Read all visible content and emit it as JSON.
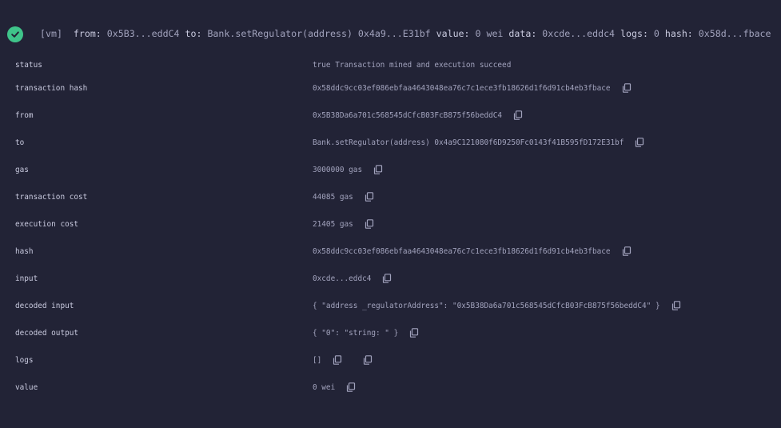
{
  "header": {
    "tag": "[vm]",
    "from_key": "from:",
    "from_val": "0x5B3...eddC4",
    "to_key": "to:",
    "to_val": "Bank.setRegulator(address) 0x4a9...E31bf",
    "value_key": "value:",
    "value_val": "0 wei",
    "data_key": "data:",
    "data_val": "0xcde...eddc4",
    "logs_key": "logs:",
    "logs_val": "0",
    "hash_key": "hash:",
    "hash_val": "0x58d...fbace",
    "status_icon": "check-circle-icon",
    "status_color": "#3fc48a"
  },
  "details": [
    {
      "label": "status",
      "value": "true Transaction mined and execution succeed",
      "copy": 0
    },
    {
      "label": "transaction hash",
      "value": "0x58ddc9cc03ef086ebfaa4643048ea76c7c1ece3fb18626d1f6d91cb4eb3fbace",
      "copy": 1
    },
    {
      "label": "from",
      "value": "0x5B38Da6a701c568545dCfcB03FcB875f56beddC4",
      "copy": 1
    },
    {
      "label": "to",
      "value": "Bank.setRegulator(address) 0x4a9C121080f6D9250Fc0143f41B595fD172E31bf",
      "copy": 1
    },
    {
      "label": "gas",
      "value": "3000000 gas",
      "copy": 1
    },
    {
      "label": "transaction cost",
      "value": "44085 gas",
      "copy": 1
    },
    {
      "label": "execution cost",
      "value": "21405 gas",
      "copy": 1
    },
    {
      "label": "hash",
      "value": "0x58ddc9cc03ef086ebfaa4643048ea76c7c1ece3fb18626d1f6d91cb4eb3fbace",
      "copy": 1
    },
    {
      "label": "input",
      "value": "0xcde...eddc4",
      "copy": 1
    },
    {
      "label": "decoded input",
      "value": "{ \"address _regulatorAddress\": \"0x5B38Da6a701c568545dCfcB03FcB875f56beddC4\" }",
      "copy": 1
    },
    {
      "label": "decoded output",
      "value": "{ \"0\": \"string: \" }",
      "copy": 1
    },
    {
      "label": "logs",
      "value": "[]",
      "copy": 2
    },
    {
      "label": "value",
      "value": "0 wei",
      "copy": 1
    }
  ]
}
